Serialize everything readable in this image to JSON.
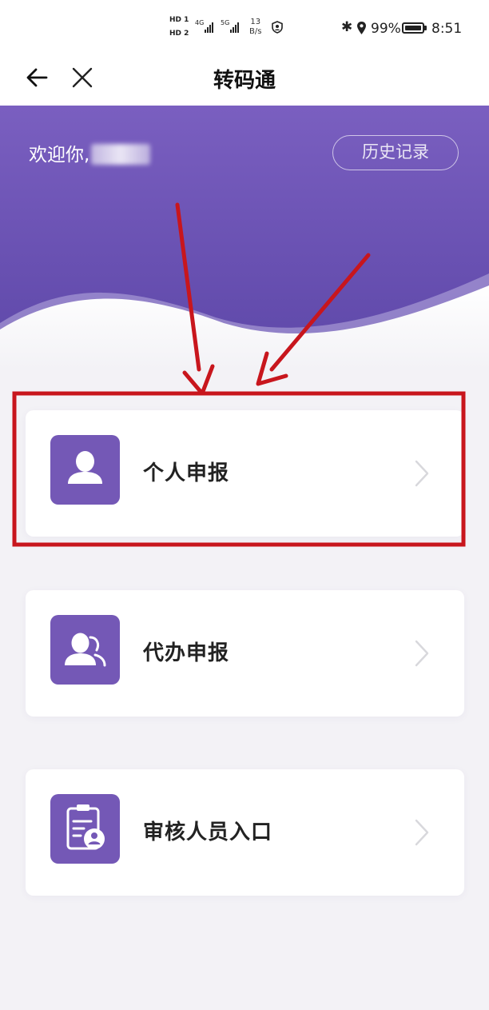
{
  "status_bar": {
    "hd1": "HD 1",
    "hd2": "HD 2",
    "sig1": "4G",
    "sig2": "5G",
    "speed_value": "13",
    "speed_unit": "B/s",
    "bluetooth_icon": "bluetooth-icon",
    "location_icon": "location-icon",
    "battery_percent": "99%",
    "time": "8:51"
  },
  "nav": {
    "back_icon": "back-arrow-icon",
    "close_icon": "close-icon",
    "title": "转码通"
  },
  "header": {
    "welcome": "欢迎你,",
    "history_button": "历史记录"
  },
  "cards": [
    {
      "label": "个人申报",
      "icon": "person-icon"
    },
    {
      "label": "代办申报",
      "icon": "two-persons-icon"
    },
    {
      "label": "审核人员入口",
      "icon": "clipboard-person-icon"
    }
  ],
  "colors": {
    "header_purple": "#6b54b3",
    "icon_purple": "#7458b6",
    "annotation_red": "#c8161d"
  }
}
